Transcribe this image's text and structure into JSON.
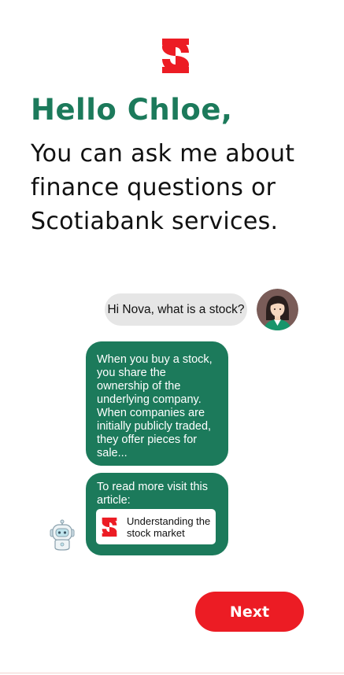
{
  "brand": {
    "logo_icon": "scotiabank-s-logo-icon",
    "accent_color": "#ec1c24",
    "primary_green": "#1c7a5b"
  },
  "header": {
    "greeting": "Hello Chloe,",
    "intro_lines": [
      "You can ask me about",
      "finance questions or",
      "Scotiabank services."
    ]
  },
  "chat": {
    "user_message": "Hi Nova, what is a stock?",
    "user_avatar_icon": "woman-avatar-icon",
    "bot_reply_lines": [
      "When you buy a stock,",
      "you share the",
      "ownership of the",
      "underlying company.",
      "When companies are",
      "initially publicly traded,",
      "they offer pieces for",
      "sale..."
    ],
    "bot_link_intro_lines": [
      "To read more visit this",
      "article:"
    ],
    "article": {
      "title_lines": [
        "Understanding the",
        "stock market"
      ],
      "icon": "scotiabank-s-logo-icon"
    },
    "bot_avatar_icon": "robot-avatar-icon"
  },
  "actions": {
    "next_label": "Next"
  }
}
